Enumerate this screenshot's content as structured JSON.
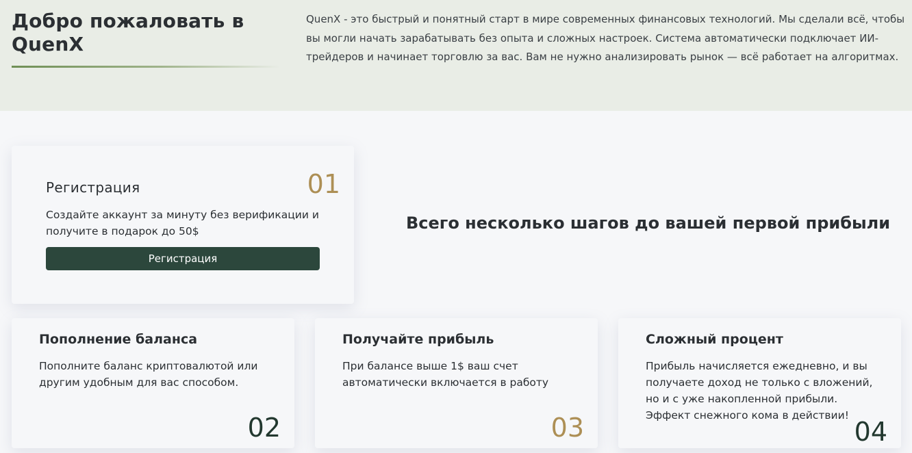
{
  "header": {
    "title": "Добро пожаловать в QuenX",
    "description": "QuenX - это быстрый и понятный старт в мире современных финансовых технологий. Мы сделали всё, чтобы вы могли начать зарабатывать без опыта и сложных настроек. Система автоматически подключает ИИ-трейдеров и начинает торговлю за вас. Вам не нужно анализировать рынок — всё работает на алгоритмах."
  },
  "steps_heading": "Всего несколько шагов до вашей первой прибыли",
  "steps": [
    {
      "number": "01",
      "title": "Регистрация",
      "text": "Создайте аккаунт за минуту без верификации и получите в подарок до 50$",
      "button_label": "Регистрация"
    },
    {
      "number": "02",
      "title": "Пополнение баланса",
      "text": "Пополните баланс криптовалютой или другим удобным для вас способом."
    },
    {
      "number": "03",
      "title": "Получайте прибыль",
      "text": "При балансе выше 1$ ваш счет автоматически включается в работу"
    },
    {
      "number": "04",
      "title": "Сложный процент",
      "text": "Прибыль начисляется ежедневно, и вы получаете доход не только с вложений, но и с уже накопленной прибыли. Эффект снежного кома в действии!"
    }
  ],
  "colors": {
    "top_band": "#e9ede6",
    "accent_gold": "#ad8f55",
    "accent_dark_green": "#2c473c"
  }
}
